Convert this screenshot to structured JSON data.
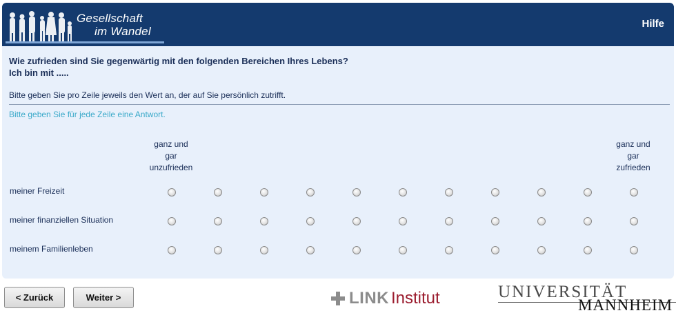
{
  "header": {
    "logo_line1": "Gesellschaft",
    "logo_line2": "im Wandel",
    "help_label": "Hilfe"
  },
  "question": {
    "title_line1": "Wie zufrieden sind Sie gegenwärtig mit den folgenden Bereichen Ihres Lebens?",
    "title_line2": "Ich bin mit .....",
    "instruction": "Bitte geben Sie pro Zeile jeweils den Wert an, der auf Sie persönlich zutrifft.",
    "warning": "Bitte geben Sie für jede Zeile eine Antwort."
  },
  "scale": {
    "left_line1": "ganz und",
    "left_line2": "gar",
    "left_line3": "unzufrieden",
    "right_line1": "ganz und",
    "right_line2": "gar",
    "right_line3": "zufrieden",
    "points": 11
  },
  "rows": [
    {
      "label": "meiner Freizeit",
      "selected": null
    },
    {
      "label": "meiner finanziellen Situation",
      "selected": null
    },
    {
      "label": "meinem Familienleben",
      "selected": null
    }
  ],
  "nav": {
    "back_label": "< Zurück",
    "next_label": "Weiter >"
  },
  "footer": {
    "link_word": "LINK",
    "link_suffix": "Institut",
    "uni_line1": "UNIVERSITÄT",
    "uni_line2": "MANNHEIM"
  },
  "colors": {
    "header_bg": "#143a6e",
    "panel_bg": "#e8f0fb",
    "warning_text": "#3aa9c9",
    "link_red": "#9b1c2e"
  }
}
